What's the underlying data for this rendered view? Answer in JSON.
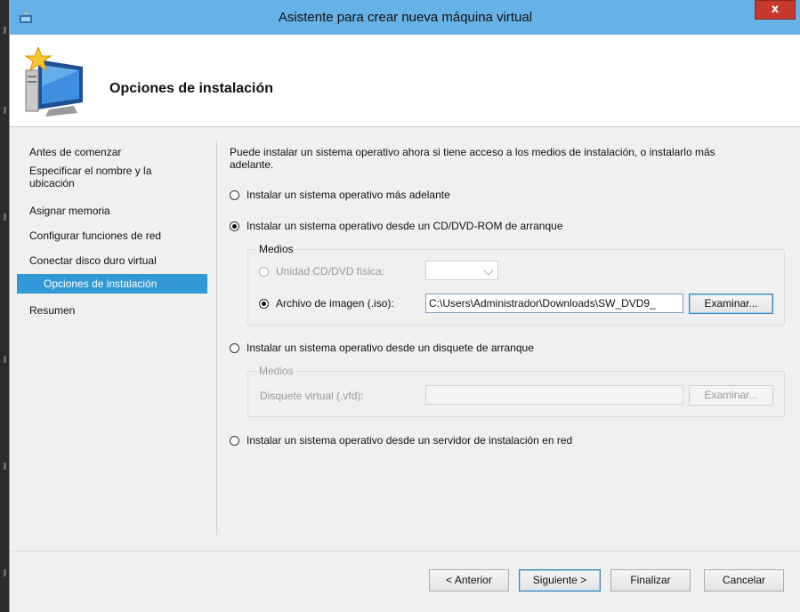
{
  "window": {
    "title": "Asistente para crear nueva máquina virtual",
    "close_label": "x"
  },
  "header": {
    "title": "Opciones de instalación",
    "icon": "computer-star-icon"
  },
  "nav": {
    "items": [
      {
        "label": "Antes de comenzar",
        "selected": false
      },
      {
        "label": "Especificar el nombre y la",
        "label2": "ubicación",
        "selected": false
      },
      {
        "label": "Asignar memoria",
        "selected": false
      },
      {
        "label": "Configurar funciones de red",
        "selected": false
      },
      {
        "label": "Conectar disco duro virtual",
        "selected": false
      },
      {
        "label": "Opciones de instalación",
        "selected": true
      },
      {
        "label": "Resumen",
        "selected": false
      }
    ]
  },
  "main": {
    "intro_line1": "Puede instalar un sistema operativo ahora si tiene acceso a los medios de instalación, o instalarlo más",
    "intro_line2": "adelante.",
    "option_later": "Instalar un sistema operativo más adelante",
    "option_cd": "Instalar un sistema operativo desde un CD/DVD-ROM de arranque",
    "cd_group": {
      "legend": "Medios",
      "physical_label": "Unidad CD/DVD física:",
      "physical_value": "",
      "iso_label": "Archivo de imagen (.iso):",
      "iso_value": "C:\\Users\\Administrador\\Downloads\\SW_DVD9_",
      "browse_label": "Examinar..."
    },
    "option_floppy": "Instalar un sistema operativo desde un disquete de arranque",
    "floppy_group": {
      "legend": "Medios",
      "vfd_label": "Disquete virtual (.vfd):",
      "vfd_value": "",
      "browse_label": "Examinar..."
    },
    "option_network": "Instalar un sistema operativo desde un servidor de instalación en red",
    "selected_option": "cd",
    "selected_media": "iso"
  },
  "footer": {
    "prev_label": "< Anterior",
    "next_label": "Siguiente >",
    "finish_label": "Finalizar",
    "cancel_label": "Cancelar"
  },
  "colors": {
    "titlebar": "#66b2e6",
    "selection": "#3399d6",
    "close": "#c7392d"
  }
}
